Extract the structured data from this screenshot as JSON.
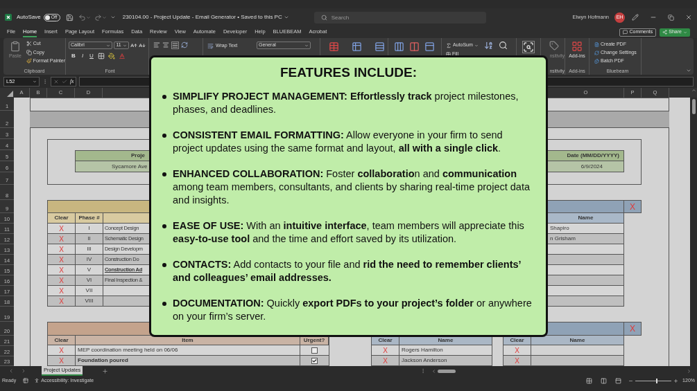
{
  "title_bar": {
    "autosave_label": "AutoSave",
    "autosave_toggle": {
      "on": false,
      "label": "Off"
    },
    "document_title": "230104.00 - Project Update - Email Generator • Saved to this PC",
    "search": {
      "placeholder": "Search"
    },
    "user_name": "Elwyn Hofmann",
    "user_initials": "EH"
  },
  "menu_tabs": [
    {
      "label": "File",
      "selected": false
    },
    {
      "label": "Home",
      "selected": true
    },
    {
      "label": "Insert",
      "selected": false
    },
    {
      "label": "Page Layout",
      "selected": false
    },
    {
      "label": "Formulas",
      "selected": false
    },
    {
      "label": "Data",
      "selected": false
    },
    {
      "label": "Review",
      "selected": false
    },
    {
      "label": "View",
      "selected": false
    },
    {
      "label": "Automate",
      "selected": false
    },
    {
      "label": "Developer",
      "selected": false
    },
    {
      "label": "Help",
      "selected": false
    },
    {
      "label": "BLUEBEAM",
      "selected": false
    },
    {
      "label": "Acrobat",
      "selected": false
    }
  ],
  "comments_button": "Comments",
  "share_button": "Share",
  "ribbon": {
    "paste": "Paste",
    "cut": "Cut",
    "copy": "Copy",
    "format_painter": "Format Painter",
    "clipboard_label": "Clipboard",
    "font_name": "Calibri",
    "font_size": "11",
    "font_styles": [
      "B",
      "I",
      "U"
    ],
    "font_label": "Font",
    "wrap_text": "Wrap Text",
    "number_format": "General",
    "autosum": "AutoSum",
    "fill": "Fill",
    "sensitivity_button": "nsitivity",
    "sensitivity_label": "nsitivity",
    "add_ins_button": "Add-ins",
    "add_ins_label": "Add-ins",
    "bluebeam_items": [
      "Create PDF",
      "Change Settings",
      "Batch PDF"
    ],
    "bluebeam_label": "Bluebeam"
  },
  "formula_bar": {
    "name_box": "L52",
    "fx": "fx"
  },
  "column_headers": {
    "left": [
      "A",
      "B",
      "C",
      "D"
    ],
    "right": [
      "O",
      "P",
      "Q"
    ]
  },
  "row_numbers": [
    "1",
    "2",
    "3",
    "4",
    "5",
    "6",
    "7",
    "8",
    "9",
    "10",
    "11",
    "12",
    "13",
    "14",
    "15",
    "16",
    "17",
    "18",
    "19",
    "20",
    "21",
    "22",
    "23"
  ],
  "sheet": {
    "project_header": "Proje",
    "project_value": "Sycamore Ave",
    "date_header": "Date (MM/DD/YYYY)",
    "date_value": "6/9/2024",
    "clear_buttons": [
      "X",
      "X"
    ],
    "phase_table": {
      "headers": [
        "Clear",
        "Phase #"
      ],
      "rows": [
        {
          "clear": "X",
          "phase": "I",
          "name": "Concept Design",
          "emphasis": false
        },
        {
          "clear": "X",
          "phase": "II",
          "name": "Schematic Design",
          "emphasis": false
        },
        {
          "clear": "X",
          "phase": "III",
          "name": "Design Developm",
          "emphasis": false
        },
        {
          "clear": "X",
          "phase": "IV",
          "name": "Construction Do",
          "emphasis": false
        },
        {
          "clear": "X",
          "phase": "V",
          "name": "Construction Ad",
          "emphasis": true
        },
        {
          "clear": "X",
          "phase": "VI",
          "name": "Final Inspection &",
          "emphasis": false
        },
        {
          "clear": "X",
          "phase": "VII"
        },
        {
          "clear": "X",
          "phase": "VIII"
        }
      ]
    },
    "team_table": {
      "header": "Name",
      "names": [
        "Shapiro",
        "n Grisham"
      ]
    },
    "updates_table": {
      "headers": [
        "Clear",
        "Item",
        "Urgent?"
      ],
      "rows": [
        {
          "clear": "X",
          "item": "MEP coordination meeting held on 06/06",
          "bold": false,
          "urgent": false
        },
        {
          "clear": "X",
          "item": "Foundation poured",
          "bold": true,
          "urgent": true
        }
      ]
    },
    "contacts_table": {
      "headers": [
        "Clear",
        "Name"
      ],
      "rows": [
        {
          "clear": "X",
          "name": "Rogers Hamilton"
        },
        {
          "clear": "X",
          "name": "Jackson Anderson"
        }
      ]
    },
    "contacts_table_2": {
      "headers": [
        "Clear",
        "Name"
      ],
      "rows": [
        {
          "clear": "X"
        },
        {
          "clear": "X"
        }
      ]
    }
  },
  "features_card": {
    "title": "FEATURES INCLUDE:",
    "items": [
      "**SIMPLIFY PROJECT MANAGEMENT: Effortlessly track** project milestones, phases, and deadlines.",
      "**CONSISTENT EMAIL FORMATTING:** Allow everyone in your firm to send project updates using the same format and layout, **all with a single click**.",
      "**ENHANCED COLLABORATION:** Foster **collaboratio**n and **communication** among team members, consultants, and clients by sharing real-time project data and insights.",
      "**EASE OF USE:** With an **intuitive interface**, team members will appreciate this **easy-to-use tool** and the time and effort saved by its utilization.",
      "**CONTACTS:** Add contacts to your file and **rid the need to remember clients’ and colleagues’ email addresses.**",
      "**DOCUMENTATION:** Quickly **export PDFs to your project’s folder** or anywhere on your firm’s server."
    ]
  },
  "sheet_tabs": [
    {
      "label": "Project Updates",
      "selected": true
    }
  ],
  "status_bar": {
    "status": "Ready",
    "accessibility": "Accessibility: Investigate",
    "zoom": "120%",
    "zoom_slider": {
      "level": 0.6
    }
  }
}
